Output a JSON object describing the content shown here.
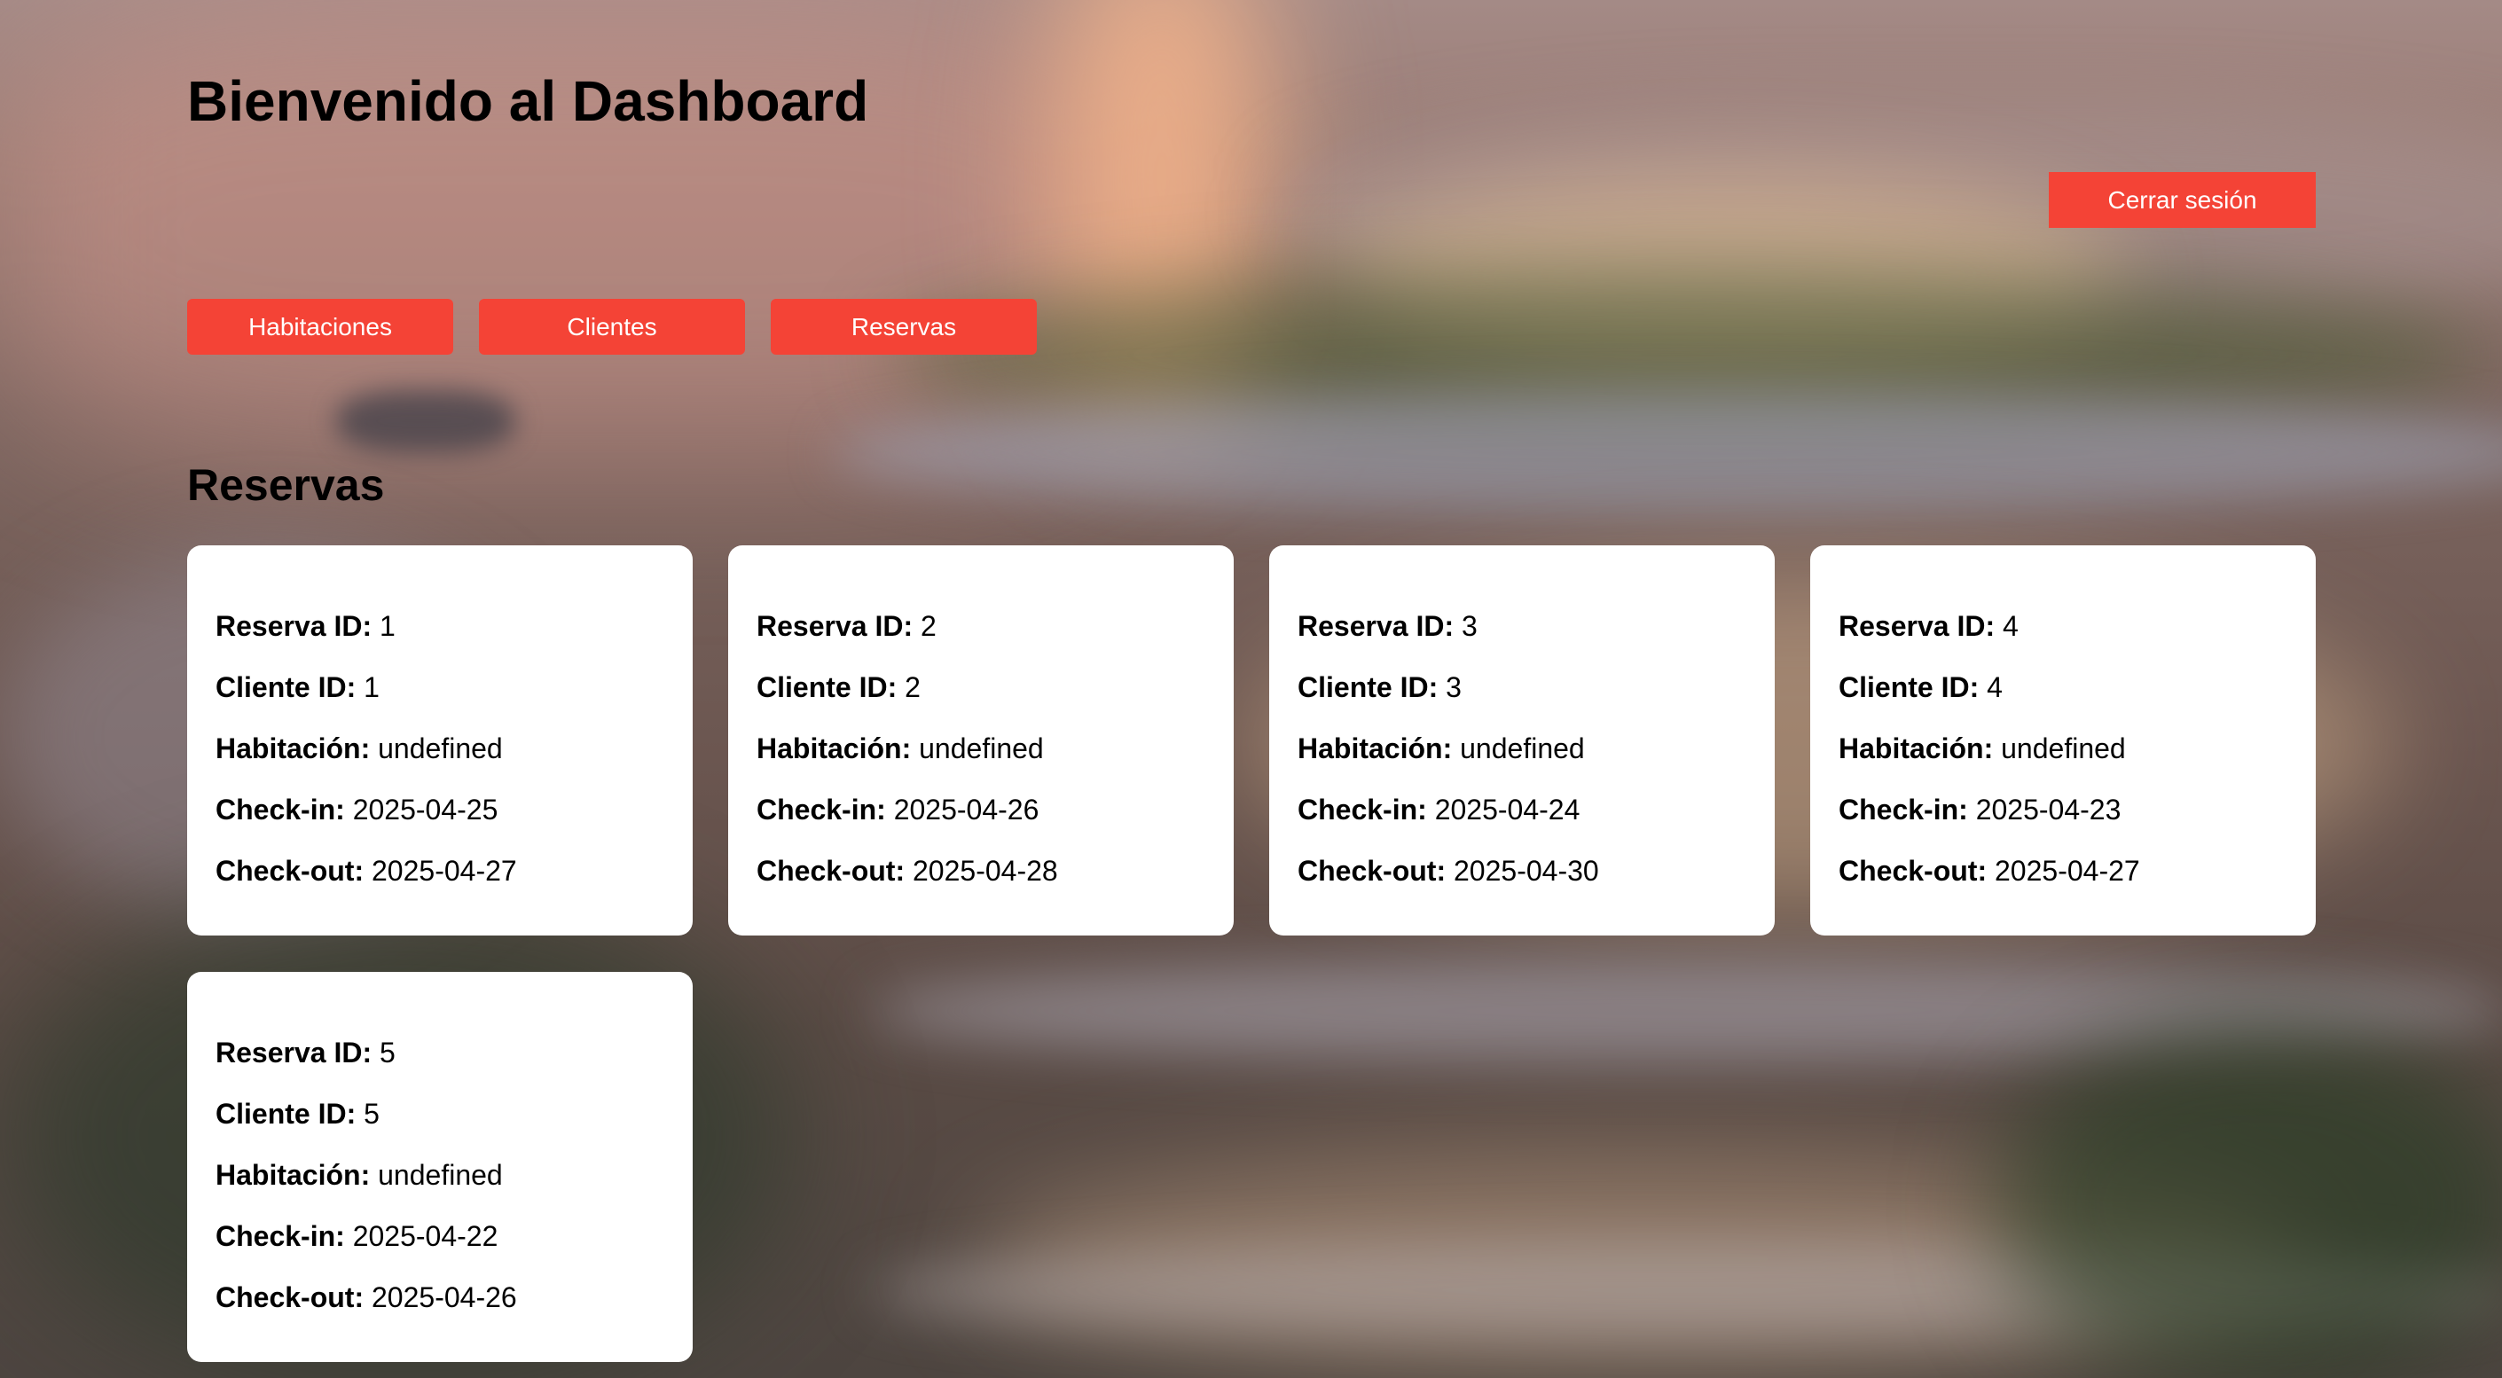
{
  "header": {
    "title": "Bienvenido al Dashboard",
    "logout_label": "Cerrar sesión"
  },
  "nav": {
    "items": [
      {
        "label": "Habitaciones"
      },
      {
        "label": "Clientes"
      },
      {
        "label": "Reservas"
      }
    ]
  },
  "section": {
    "title": "Reservas"
  },
  "labels": {
    "reserva_id": "Reserva ID:",
    "cliente_id": "Cliente ID:",
    "habitacion": "Habitación:",
    "checkin": "Check-in:",
    "checkout": "Check-out:"
  },
  "reservas": [
    {
      "reserva_id": "1",
      "cliente_id": "1",
      "habitacion": "undefined",
      "checkin": "2025-04-25",
      "checkout": "2025-04-27"
    },
    {
      "reserva_id": "2",
      "cliente_id": "2",
      "habitacion": "undefined",
      "checkin": "2025-04-26",
      "checkout": "2025-04-28"
    },
    {
      "reserva_id": "3",
      "cliente_id": "3",
      "habitacion": "undefined",
      "checkin": "2025-04-24",
      "checkout": "2025-04-30"
    },
    {
      "reserva_id": "4",
      "cliente_id": "4",
      "habitacion": "undefined",
      "checkin": "2025-04-23",
      "checkout": "2025-04-27"
    },
    {
      "reserva_id": "5",
      "cliente_id": "5",
      "habitacion": "undefined",
      "checkin": "2025-04-22",
      "checkout": "2025-04-26"
    }
  ],
  "colors": {
    "accent": "#f44336",
    "card": "#ffffff"
  }
}
